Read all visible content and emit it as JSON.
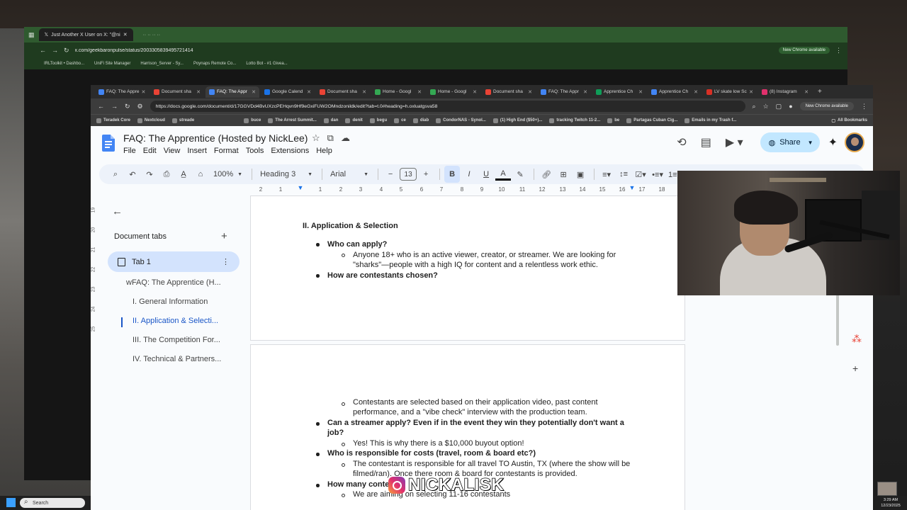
{
  "back_browser": {
    "tabs": [
      "Just Another X User on X: \"@ni"
    ],
    "url": "x.com/geekbaronpulse/status/2003305839495721414",
    "bookmarks": [
      "IRLToolkit • Dashbo...",
      "UniFi Site Manager",
      "Harrison_Server - Sy...",
      "Poynaps Remote Co...",
      "Lotto Bot - #1 Givea..."
    ],
    "chrome_pill": "New Chrome available"
  },
  "front_browser": {
    "tabs": [
      {
        "label": "FAQ: The Appre",
        "color": "#4285f4"
      },
      {
        "label": "Document sha",
        "color": "#ea4335"
      },
      {
        "label": "FAQ: The Appr",
        "color": "#4285f4",
        "active": true
      },
      {
        "label": "Google Calend",
        "color": "#1a73e8"
      },
      {
        "label": "Document sha",
        "color": "#ea4335"
      },
      {
        "label": "Home - Googl",
        "color": "#34a853"
      },
      {
        "label": "Home - Googl",
        "color": "#34a853"
      },
      {
        "label": "Document sha",
        "color": "#ea4335"
      },
      {
        "label": "FAQ: The Appr",
        "color": "#4285f4"
      },
      {
        "label": "Apprentice Ch",
        "color": "#0f9d58"
      },
      {
        "label": "Apprentice Ch",
        "color": "#4285f4"
      },
      {
        "label": "LV skate low Sc",
        "color": "#d93025"
      },
      {
        "label": "(8) Instagram",
        "color": "#e1306c"
      }
    ],
    "url": "https://docs.google.com/document/d/17GGVDd4BvUXzcPEHqvn9Hf9eGxiFUW2OMndzonildk/edit?tab=t.0#heading=h.oxluatgsva58",
    "chrome_pill": "New Chrome available",
    "bookmarks": [
      "Teradek Core",
      "Nextcloud",
      "streade",
      "buce",
      "The Arrest Summit...",
      "dan",
      "denit",
      "begu",
      "ce",
      "diab",
      "CondorNAS - Synol...",
      "(1) High End ($50+)...",
      "tracking Twitch 11-2...",
      "be",
      "Partagas Cuban Cig...",
      "Emails in my Trash f..."
    ],
    "all_bookmarks": "All Bookmarks"
  },
  "docs": {
    "title": "FAQ: The Apprentice (Hosted by NickLee)",
    "menu": [
      "File",
      "Edit",
      "View",
      "Insert",
      "Format",
      "Tools",
      "Extensions",
      "Help"
    ],
    "share_label": "Share",
    "toolbar": {
      "zoom": "100%",
      "style": "Heading 3",
      "font": "Arial",
      "size": "13"
    },
    "ruler_ticks": [
      "2",
      "1",
      "1",
      "2",
      "3",
      "4",
      "5",
      "6",
      "7",
      "8",
      "9",
      "10",
      "11",
      "12",
      "13",
      "14",
      "15",
      "16",
      "17",
      "18"
    ],
    "vruler_ticks": [
      "19",
      "20",
      "21",
      "22",
      "23",
      "24",
      "25"
    ],
    "sidebar": {
      "heading": "Document tabs",
      "tab1": "Tab 1",
      "outline": [
        "wFAQ: The Apprentice (H...",
        "I. General Information",
        "II. Application & Selecti...",
        "III. The Competition For...",
        "IV. Technical & Partners..."
      ],
      "active_index": 2
    },
    "page1": {
      "heading": "II. Application & Selection",
      "q1": "Who can apply?",
      "a1_line1": "Anyone 18+ who is an active viewer, creator, or streamer. We are looking for",
      "a1_line2": "\"sharks\"—people with a high IQ for content and a relentless work ethic.",
      "q2": "How are contestants chosen?"
    },
    "page2": {
      "a2_line1": "Contestants are selected based on their application video, past content",
      "a2_line2": "performance, and a \"vibe check\" interview with the production team.",
      "q3_line1": "Can a streamer apply?  Even if in the event they win they potentially don't want a",
      "q3_line2": "job?",
      "a3": "Yes!  This is why there is a $10,000 buyout option!",
      "q4": "Who is responsible for costs (travel, room & board etc?)",
      "a4_line1": "The contestant is responsible for all travel TO Austin, TX (where the show will be",
      "a4_line2": "filmed/ran).  Once there room & board for contestants is provided.",
      "q5": "How many conte",
      "a5": "We are aiming on selecting 11-16 contestants"
    }
  },
  "overlay": {
    "name": "NICKALISK"
  },
  "taskbar": {
    "search": "Search",
    "time": "3:29 AM",
    "date": "12/23/2025"
  }
}
